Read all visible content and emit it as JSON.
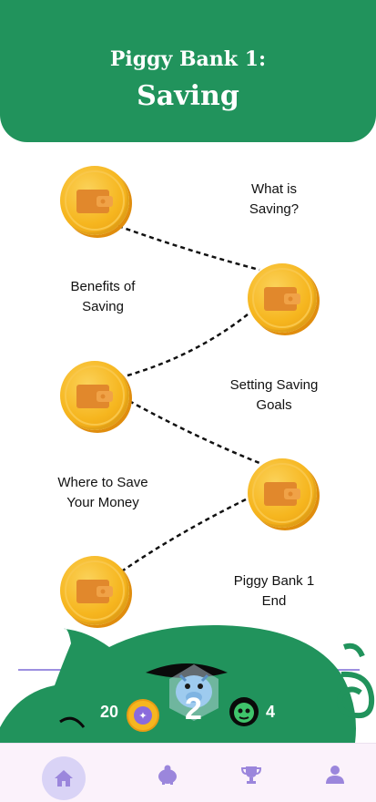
{
  "header": {
    "subtitle": "Piggy Bank 1:",
    "title": "Saving"
  },
  "lessons": [
    {
      "label_line1": "What is",
      "label_line2": "Saving?"
    },
    {
      "label_line1": "Benefits of",
      "label_line2": "Saving"
    },
    {
      "label_line1": "Setting Saving",
      "label_line2": "Goals"
    },
    {
      "label_line1": "Where to Save",
      "label_line2": "Your Money"
    },
    {
      "label_line1": "Piggy Bank 1",
      "label_line2": "End"
    }
  ],
  "stats": {
    "coins": "20",
    "level": "2",
    "monsters": "4"
  },
  "nav": {
    "items": [
      {
        "icon": "home-icon",
        "active": true
      },
      {
        "icon": "piggy-bank-icon",
        "active": false
      },
      {
        "icon": "trophy-icon",
        "active": false
      },
      {
        "icon": "profile-icon",
        "active": false
      }
    ]
  },
  "colors": {
    "primary": "#21935c",
    "coin": "#f6b61f",
    "nav_active": "#d9d3f6",
    "nav_icon": "#9b86dc"
  }
}
